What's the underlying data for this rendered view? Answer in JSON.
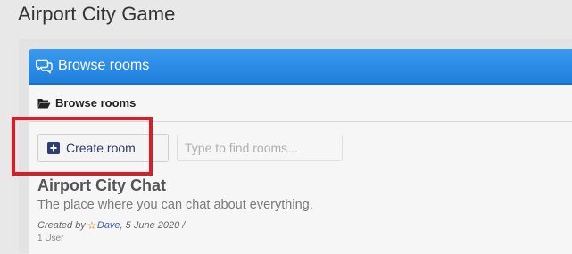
{
  "app": {
    "title": "Airport City Game"
  },
  "card": {
    "header_title": "Browse rooms",
    "header_icon": "chat-bubbles-icon",
    "subheader_title": "Browse rooms",
    "subheader_icon": "folder-open-icon"
  },
  "toolbar": {
    "create_label": "Create room",
    "create_icon": "plus-square-icon",
    "search_placeholder": "Type to find rooms..."
  },
  "room": {
    "title": "Airport City Chat",
    "description": "The place where you can chat about everything.",
    "created_by": "Created by",
    "author": "Dave",
    "date": ", 5 June 2020 /",
    "count": "1 User"
  },
  "colors": {
    "header_blue": "#2a8ae6",
    "highlight_red": "#e01b24",
    "button_icon_navy": "#2e3d78"
  }
}
